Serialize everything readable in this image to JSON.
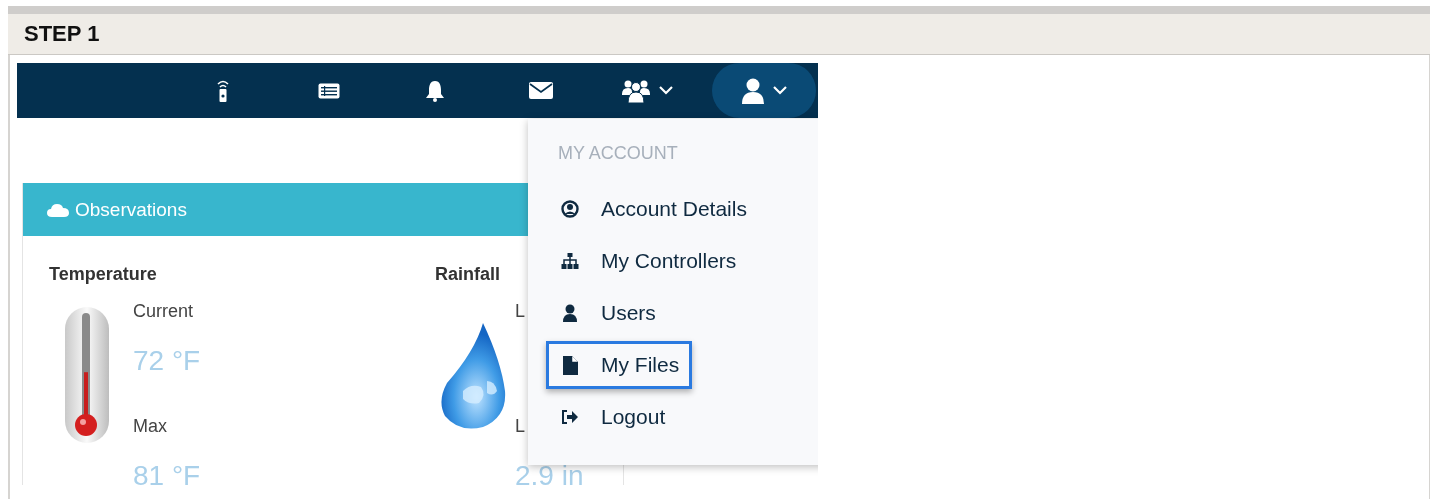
{
  "step": {
    "title": "STEP 1"
  },
  "navbar": {
    "items": [
      {
        "kind": "remote",
        "selected": false,
        "caret": false
      },
      {
        "kind": "list",
        "selected": false,
        "caret": false
      },
      {
        "kind": "bell",
        "selected": false,
        "caret": false
      },
      {
        "kind": "mail",
        "selected": false,
        "caret": false
      },
      {
        "kind": "group",
        "selected": false,
        "caret": true
      },
      {
        "kind": "user",
        "selected": true,
        "caret": true
      }
    ]
  },
  "card": {
    "title": "Observations",
    "temperature": {
      "heading": "Temperature",
      "labels": [
        "Current",
        "Max"
      ],
      "values": [
        "72 °F",
        "81 °F"
      ],
      "level": 0.45
    },
    "rainfall": {
      "heading": "Rainfall",
      "labels": [
        "L",
        "L"
      ],
      "values": [
        "2.9 in"
      ]
    }
  },
  "dropdown": {
    "heading": "MY ACCOUNT",
    "items": [
      {
        "kind": "account",
        "label": "Account Details",
        "highlighted": false
      },
      {
        "kind": "sitemap",
        "label": "My Controllers",
        "highlighted": false
      },
      {
        "kind": "user",
        "label": "Users",
        "highlighted": false
      },
      {
        "kind": "file",
        "label": "My Files",
        "highlighted": true
      },
      {
        "kind": "logout",
        "label": "Logout",
        "highlighted": false
      }
    ]
  }
}
